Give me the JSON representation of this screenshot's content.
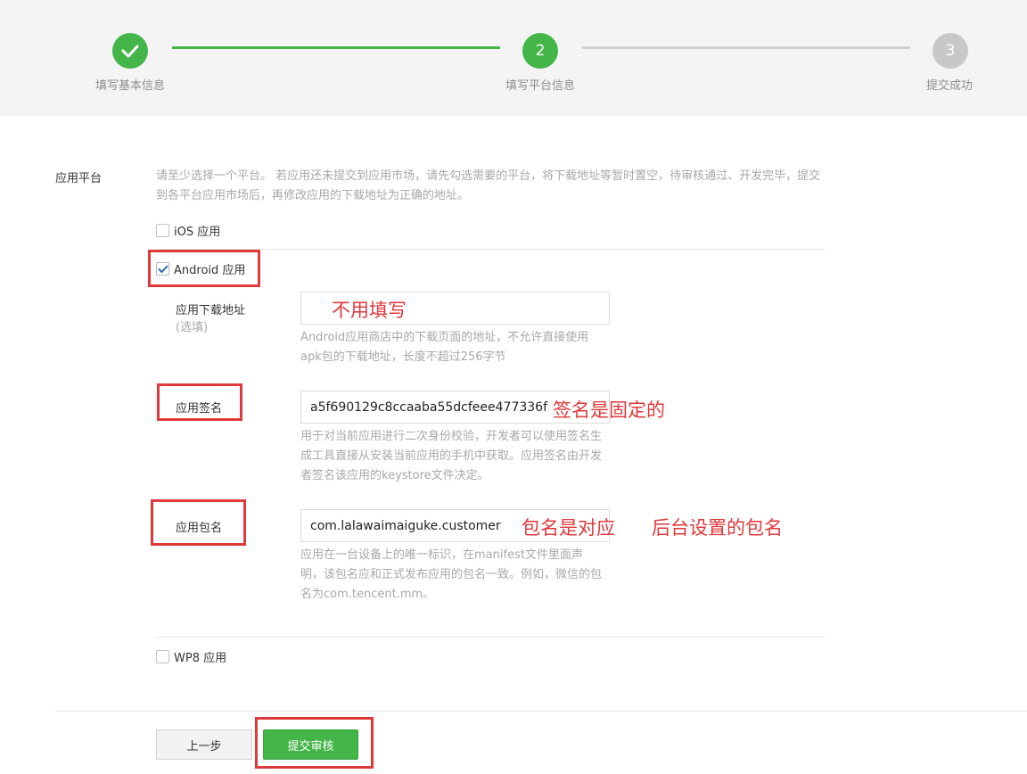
{
  "steps": [
    {
      "label": "填写基本信息",
      "status": "done"
    },
    {
      "label": "填写平台信息",
      "number": "2",
      "status": "active"
    },
    {
      "label": "提交成功",
      "number": "3",
      "status": "todo"
    }
  ],
  "platform": {
    "title": "应用平台",
    "hint": "请至少选择一个平台。 若应用还未提交到应用市场，请先勾选需要的平台，将下载地址等暂时置空，待审核通过、开发完毕，提交到各平台应用市场后，再修改应用的下载地址为正确的地址。",
    "ios_label": "iOS 应用",
    "android_label": "Android 应用",
    "wp8_label": "WP8 应用"
  },
  "android": {
    "download": {
      "label": "应用下载地址",
      "optional": "(选填)",
      "value": "",
      "hint": "Android应用商店中的下载页面的地址，不允许直接使用apk包的下载地址，长度不超过256字节"
    },
    "signature": {
      "label": "应用签名",
      "value": "a5f690129c8ccaaba55dcfeee477336f",
      "hint": "用于对当前应用进行二次身份校验，开发者可以使用签名生成工具直接从安装当前应用的手机中获取。应用签名由开发者签名该应用的keystore文件决定。"
    },
    "package": {
      "label": "应用包名",
      "value": "com.lalawaimaiguke.customer",
      "hint": "应用在一台设备上的唯一标识，在manifest文件里面声明，该包名应和正式发布应用的包名一致。例如，微信的包名为com.tencent.mm。"
    }
  },
  "annotations": {
    "download": "不用填写",
    "signature": "签名是固定的",
    "package_1": "包名是对应",
    "package_2": "后台设置的包名"
  },
  "buttons": {
    "prev": "上一步",
    "submit": "提交审核"
  },
  "colors": {
    "primary_green": "#44b549",
    "annotation_red": "#e0383b"
  }
}
